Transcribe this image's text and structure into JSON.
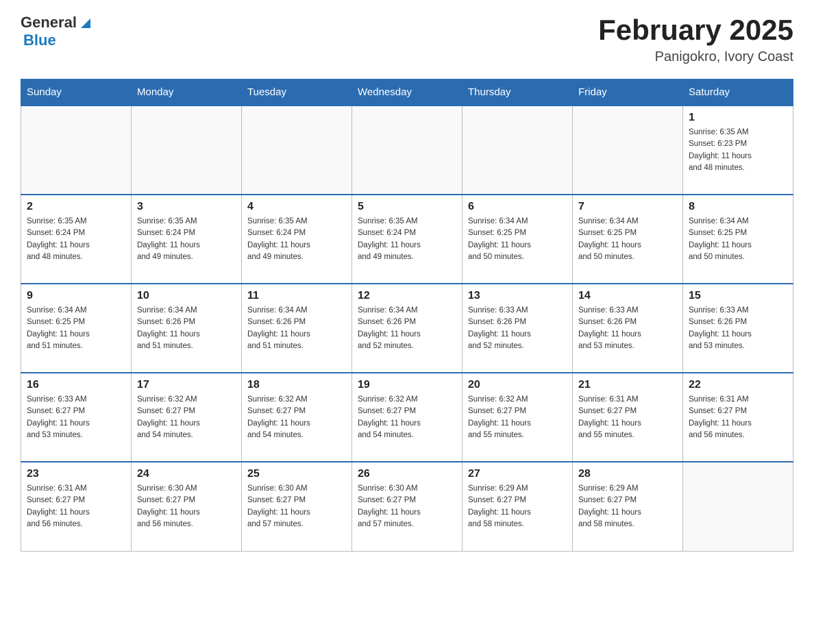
{
  "header": {
    "logo_general": "General",
    "logo_blue": "Blue",
    "month_title": "February 2025",
    "location": "Panigokro, Ivory Coast"
  },
  "days_of_week": [
    "Sunday",
    "Monday",
    "Tuesday",
    "Wednesday",
    "Thursday",
    "Friday",
    "Saturday"
  ],
  "weeks": [
    [
      {
        "day": "",
        "info": ""
      },
      {
        "day": "",
        "info": ""
      },
      {
        "day": "",
        "info": ""
      },
      {
        "day": "",
        "info": ""
      },
      {
        "day": "",
        "info": ""
      },
      {
        "day": "",
        "info": ""
      },
      {
        "day": "1",
        "info": "Sunrise: 6:35 AM\nSunset: 6:23 PM\nDaylight: 11 hours\nand 48 minutes."
      }
    ],
    [
      {
        "day": "2",
        "info": "Sunrise: 6:35 AM\nSunset: 6:24 PM\nDaylight: 11 hours\nand 48 minutes."
      },
      {
        "day": "3",
        "info": "Sunrise: 6:35 AM\nSunset: 6:24 PM\nDaylight: 11 hours\nand 49 minutes."
      },
      {
        "day": "4",
        "info": "Sunrise: 6:35 AM\nSunset: 6:24 PM\nDaylight: 11 hours\nand 49 minutes."
      },
      {
        "day": "5",
        "info": "Sunrise: 6:35 AM\nSunset: 6:24 PM\nDaylight: 11 hours\nand 49 minutes."
      },
      {
        "day": "6",
        "info": "Sunrise: 6:34 AM\nSunset: 6:25 PM\nDaylight: 11 hours\nand 50 minutes."
      },
      {
        "day": "7",
        "info": "Sunrise: 6:34 AM\nSunset: 6:25 PM\nDaylight: 11 hours\nand 50 minutes."
      },
      {
        "day": "8",
        "info": "Sunrise: 6:34 AM\nSunset: 6:25 PM\nDaylight: 11 hours\nand 50 minutes."
      }
    ],
    [
      {
        "day": "9",
        "info": "Sunrise: 6:34 AM\nSunset: 6:25 PM\nDaylight: 11 hours\nand 51 minutes."
      },
      {
        "day": "10",
        "info": "Sunrise: 6:34 AM\nSunset: 6:26 PM\nDaylight: 11 hours\nand 51 minutes."
      },
      {
        "day": "11",
        "info": "Sunrise: 6:34 AM\nSunset: 6:26 PM\nDaylight: 11 hours\nand 51 minutes."
      },
      {
        "day": "12",
        "info": "Sunrise: 6:34 AM\nSunset: 6:26 PM\nDaylight: 11 hours\nand 52 minutes."
      },
      {
        "day": "13",
        "info": "Sunrise: 6:33 AM\nSunset: 6:26 PM\nDaylight: 11 hours\nand 52 minutes."
      },
      {
        "day": "14",
        "info": "Sunrise: 6:33 AM\nSunset: 6:26 PM\nDaylight: 11 hours\nand 53 minutes."
      },
      {
        "day": "15",
        "info": "Sunrise: 6:33 AM\nSunset: 6:26 PM\nDaylight: 11 hours\nand 53 minutes."
      }
    ],
    [
      {
        "day": "16",
        "info": "Sunrise: 6:33 AM\nSunset: 6:27 PM\nDaylight: 11 hours\nand 53 minutes."
      },
      {
        "day": "17",
        "info": "Sunrise: 6:32 AM\nSunset: 6:27 PM\nDaylight: 11 hours\nand 54 minutes."
      },
      {
        "day": "18",
        "info": "Sunrise: 6:32 AM\nSunset: 6:27 PM\nDaylight: 11 hours\nand 54 minutes."
      },
      {
        "day": "19",
        "info": "Sunrise: 6:32 AM\nSunset: 6:27 PM\nDaylight: 11 hours\nand 54 minutes."
      },
      {
        "day": "20",
        "info": "Sunrise: 6:32 AM\nSunset: 6:27 PM\nDaylight: 11 hours\nand 55 minutes."
      },
      {
        "day": "21",
        "info": "Sunrise: 6:31 AM\nSunset: 6:27 PM\nDaylight: 11 hours\nand 55 minutes."
      },
      {
        "day": "22",
        "info": "Sunrise: 6:31 AM\nSunset: 6:27 PM\nDaylight: 11 hours\nand 56 minutes."
      }
    ],
    [
      {
        "day": "23",
        "info": "Sunrise: 6:31 AM\nSunset: 6:27 PM\nDaylight: 11 hours\nand 56 minutes."
      },
      {
        "day": "24",
        "info": "Sunrise: 6:30 AM\nSunset: 6:27 PM\nDaylight: 11 hours\nand 56 minutes."
      },
      {
        "day": "25",
        "info": "Sunrise: 6:30 AM\nSunset: 6:27 PM\nDaylight: 11 hours\nand 57 minutes."
      },
      {
        "day": "26",
        "info": "Sunrise: 6:30 AM\nSunset: 6:27 PM\nDaylight: 11 hours\nand 57 minutes."
      },
      {
        "day": "27",
        "info": "Sunrise: 6:29 AM\nSunset: 6:27 PM\nDaylight: 11 hours\nand 58 minutes."
      },
      {
        "day": "28",
        "info": "Sunrise: 6:29 AM\nSunset: 6:27 PM\nDaylight: 11 hours\nand 58 minutes."
      },
      {
        "day": "",
        "info": ""
      }
    ]
  ]
}
